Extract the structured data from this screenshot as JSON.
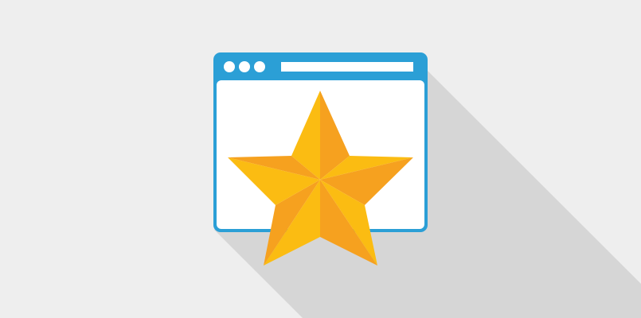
{
  "illustration": {
    "subject": "browser-window-with-star-icon",
    "colors": {
      "background": "#eeeeee",
      "long_shadow": "#d6d6d6",
      "window_frame": "#2b9fd6",
      "window_body": "#ffffff",
      "window_dots": "#ffffff",
      "address_bar": "#ffffff",
      "star_light": "#fbbc12",
      "star_dark": "#f6a11f"
    },
    "window_dots_count": 3
  }
}
